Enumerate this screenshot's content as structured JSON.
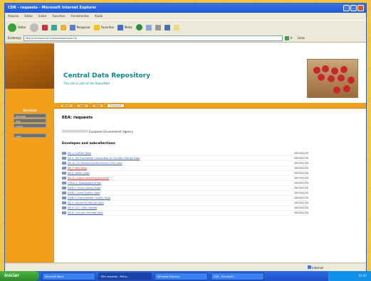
{
  "window": {
    "title": "CDR - requests - Microsoft Internet Explorer"
  },
  "menu": [
    "Arquivo",
    "Exibir",
    "Favoritos",
    "Ferramentas",
    "Ajuda",
    "Editar"
  ],
  "toolbar": {
    "back": "Voltar",
    "search": "Pesquisar",
    "favorites": "Favoritos",
    "media": "Mídia"
  },
  "address": {
    "label": "Endereço",
    "url": "http://cdr.eionet.eu.int/es/eea/envqmr7w",
    "go": "Ir",
    "links": "Links"
  },
  "site": {
    "title": "Central Data Repository",
    "subtitle": "This site is part of the ReportNet"
  },
  "nav": [
    "Home",
    "Login",
    "Help",
    "Envelopes"
  ],
  "sidebar": {
    "heading": "Services",
    "items": [
      "Overview",
      "Help",
      "Logout",
      "Login"
    ]
  },
  "page": {
    "title": "EEA: requests",
    "owner": "European Environment Agency",
    "section": "Envelopes and subcollections"
  },
  "rows": [
    {
      "label": "NE-1: CLRTAP Data",
      "date": "2003/01/30",
      "red": false
    },
    {
      "label": "NE-2: UN Framework Convention on Climate Change Data",
      "date": "2003/01/30",
      "red": false
    },
    {
      "label": "NE-3L: EC Monitoring Mechanism GHG Data",
      "date": "2003/01/30",
      "red": false
    },
    {
      "label": "NE-7: Bird Data",
      "date": "2003/01/30",
      "red": true
    },
    {
      "label": "NE-5: Water Data",
      "date": "2003/01/30",
      "red": false
    },
    {
      "label": "NE-2L: Ozone reporting guideline",
      "date": "2003/01/30",
      "red": true
    },
    {
      "label": "CDDA-1: Designated Areas",
      "date": "2003/01/30",
      "red": false
    },
    {
      "label": "EWN-1: River Quality Data",
      "date": "2003/01/30",
      "red": false
    },
    {
      "label": "EWN-2: Lake Quality Data",
      "date": "2003/01/30",
      "red": false
    },
    {
      "label": "EWN-3: Groundwater Quality Data",
      "date": "2003/01/30",
      "red": false
    },
    {
      "label": "NE-3: Access to Natural Data",
      "date": "2003/01/30",
      "red": false
    },
    {
      "label": "NE-4: CLC 2000 Update",
      "date": "2003/01/30",
      "red": false
    },
    {
      "label": "NE-6: Cultural heritage Data",
      "date": "2003/01/30",
      "red": false
    }
  ],
  "status": {
    "text": "",
    "zone": "Internet"
  },
  "taskbar": {
    "start": "Iniciar",
    "tasks": [
      "Microsoft Word",
      "EEA requests - Micro...",
      "Windows Explorer",
      "CDR - Microsoft..."
    ],
    "clock": "15:47"
  }
}
